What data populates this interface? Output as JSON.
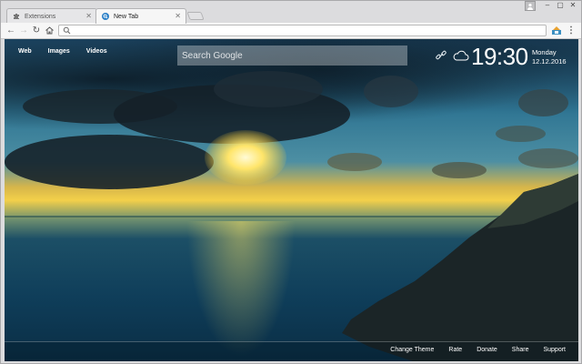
{
  "browser": {
    "tabs": [
      {
        "title": "Extensions",
        "icon": "puzzle-icon",
        "active": false
      },
      {
        "title": "New Tab",
        "icon": "search-icon",
        "active": true
      }
    ],
    "address_bar": {
      "value": "",
      "placeholder": ""
    },
    "colors": {
      "frame": "#dcdcde",
      "toolbar": "#f6f6f6"
    }
  },
  "newtab": {
    "search_links": [
      "Web",
      "Images",
      "Videos"
    ],
    "search_placeholder": "Search Google",
    "clock": "19:30",
    "day": "Monday",
    "date": "12.12.2016",
    "weather_icon": "cloud-icon",
    "footer_links": [
      "Change Theme",
      "Rate",
      "Donate",
      "Share",
      "Support"
    ]
  }
}
